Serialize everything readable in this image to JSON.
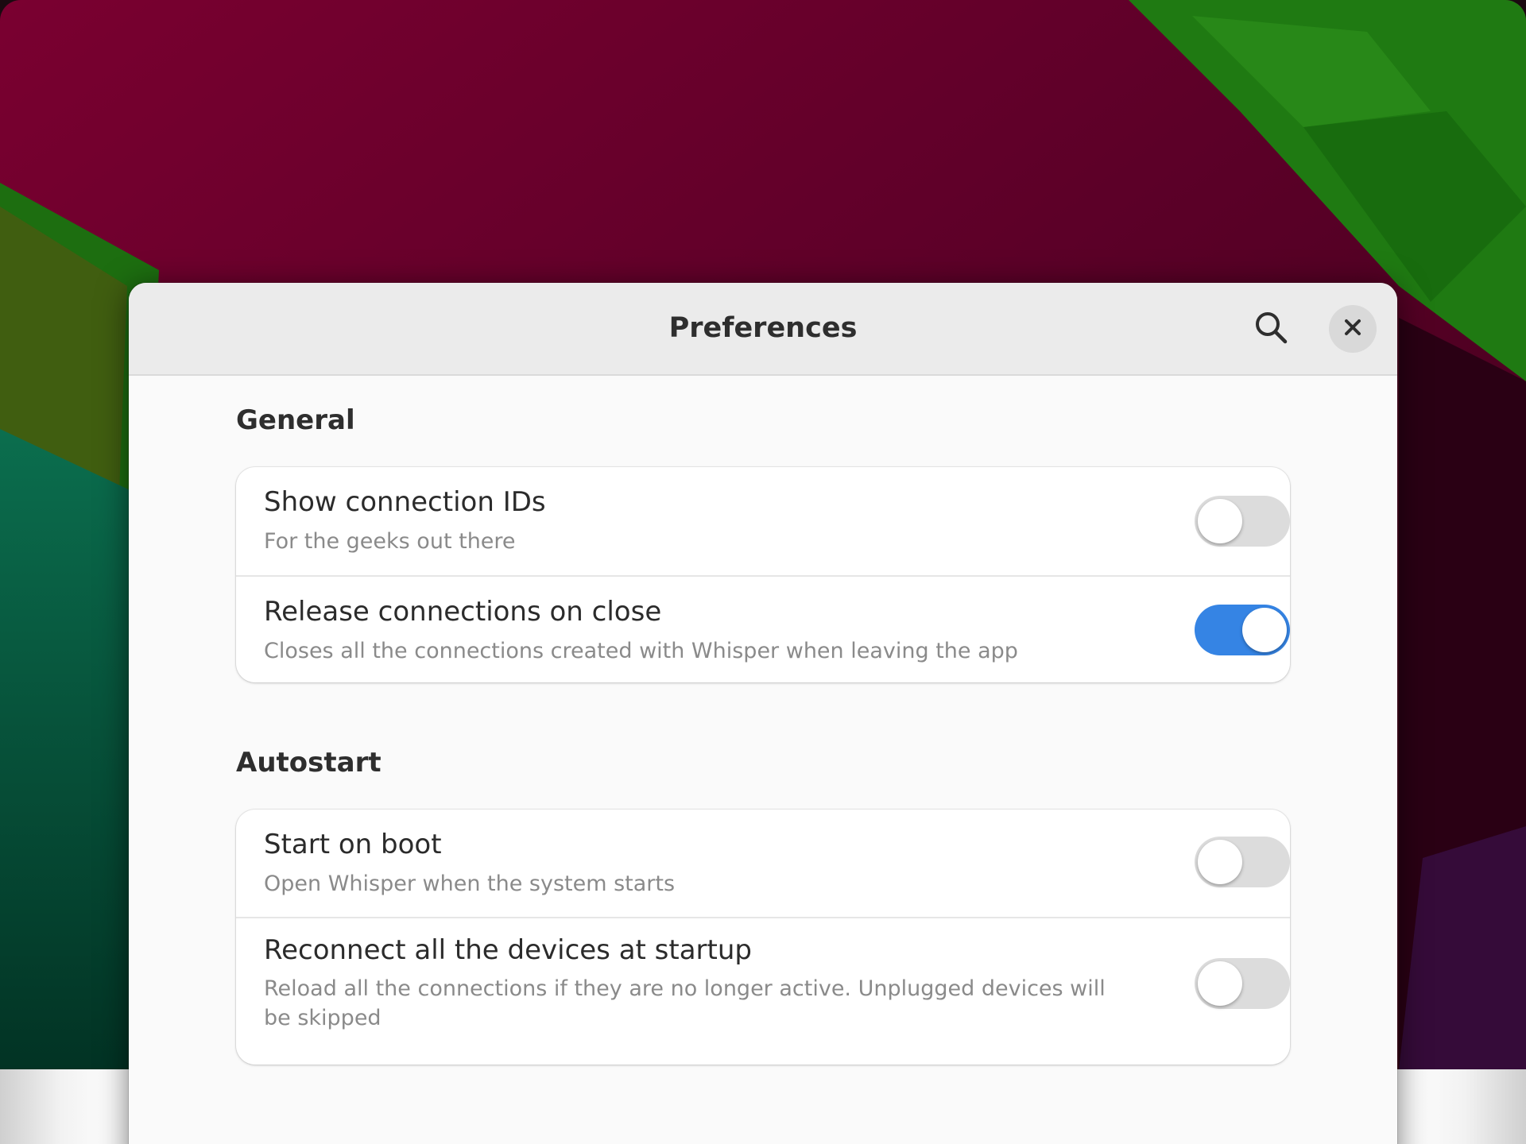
{
  "dialog": {
    "title": "Preferences"
  },
  "sections": [
    {
      "title": "General",
      "rows": [
        {
          "title": "Show connection IDs",
          "subtitle": "For the geeks out there",
          "enabled": false
        },
        {
          "title": "Release connections on close",
          "subtitle": "Closes all the connections created with Whisper when leaving the app",
          "enabled": true
        }
      ]
    },
    {
      "title": "Autostart",
      "rows": [
        {
          "title": "Start on boot",
          "subtitle": "Open Whisper when the system starts",
          "enabled": false
        },
        {
          "title": "Reconnect all the devices at startup",
          "subtitle": "Reload all the connections if they are no longer active. Unplugged devices will be skipped",
          "enabled": false
        }
      ]
    }
  ],
  "colors": {
    "accent": "#3584e4",
    "toggle_off": "#dcdcdc",
    "headerbar": "#ebebeb"
  },
  "icons": {
    "search": "search-icon",
    "close": "close-icon"
  }
}
